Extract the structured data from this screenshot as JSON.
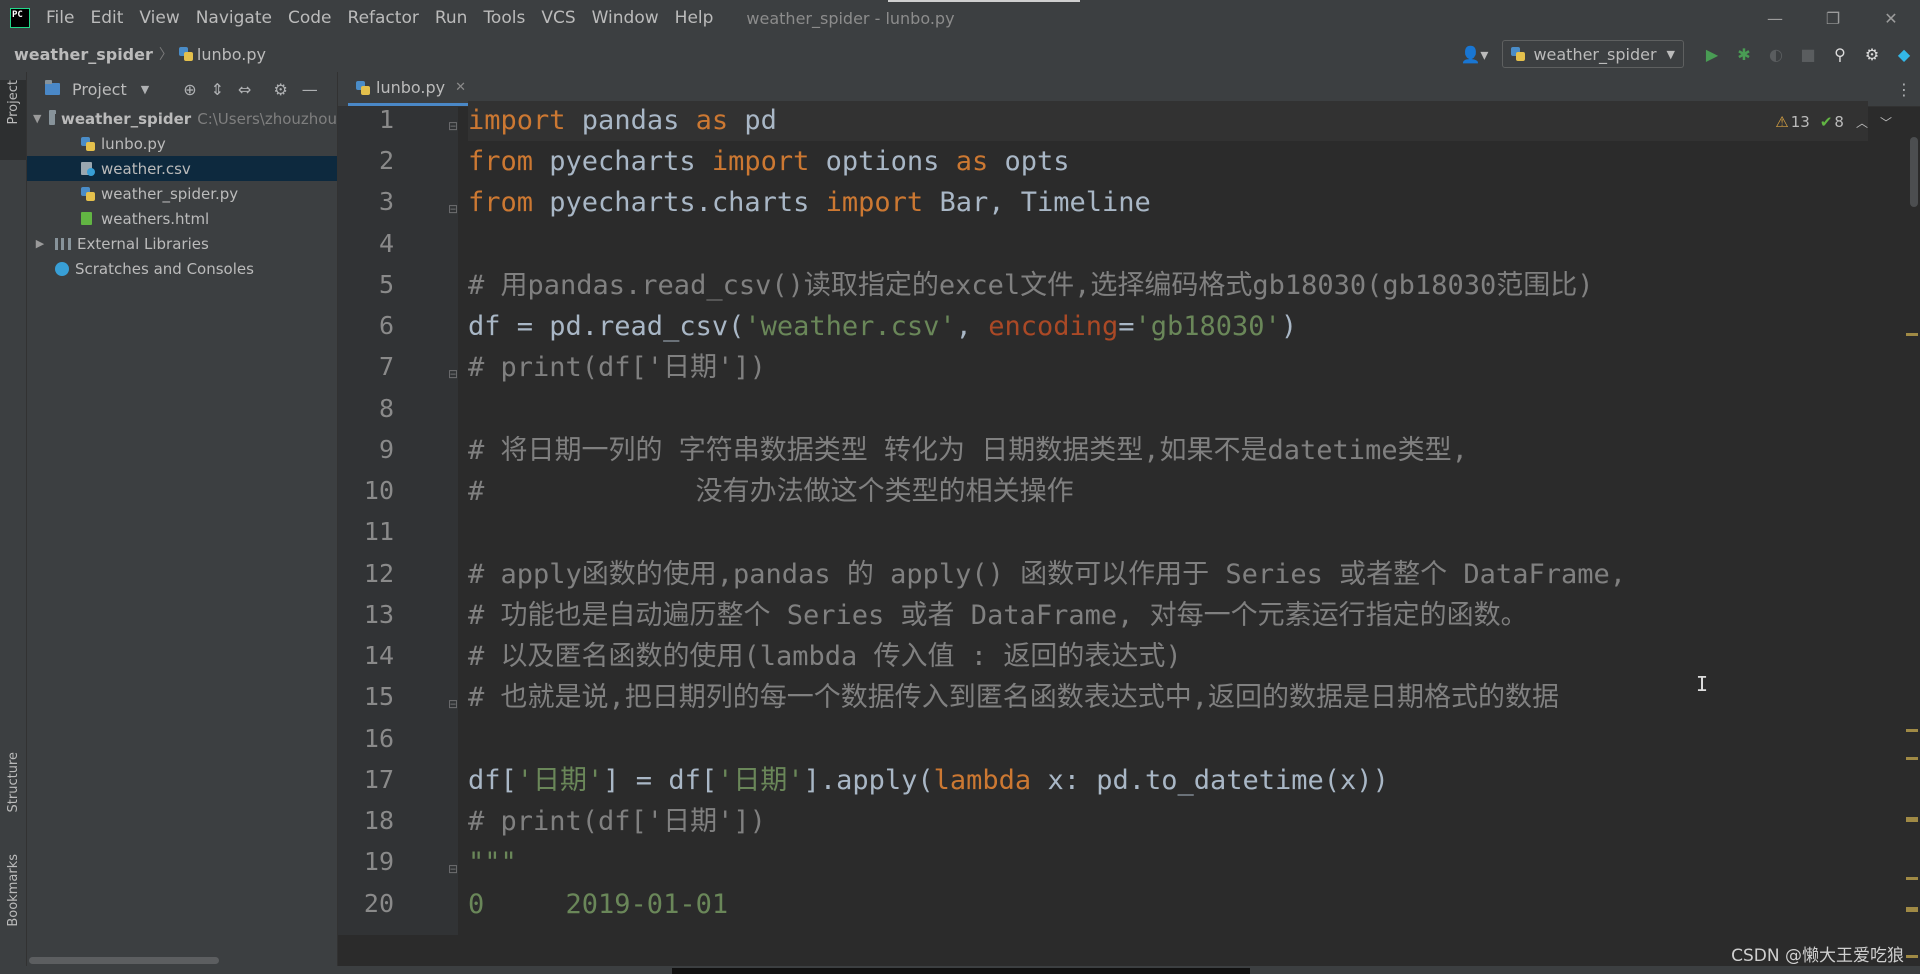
{
  "menu": {
    "items": [
      "File",
      "Edit",
      "View",
      "Navigate",
      "Code",
      "Refactor",
      "Run",
      "Tools",
      "VCS",
      "Window",
      "Help"
    ],
    "window_title": "weather_spider - lunbo.py"
  },
  "window_controls": {
    "minimize": "—",
    "restore": "❐",
    "close": "✕"
  },
  "breadcrumb": {
    "project": "weather_spider",
    "file": "lunbo.py"
  },
  "run_config": {
    "name": "weather_spider"
  },
  "project_panel": {
    "title": "Project",
    "root": {
      "name": "weather_spider",
      "path": "C:\\Users\\zhouzhou"
    },
    "files": [
      "lunbo.py",
      "weather.csv",
      "weather_spider.py",
      "weathers.html"
    ],
    "external_libraries": "External Libraries",
    "scratches": "Scratches and Consoles",
    "selected": "weather.csv"
  },
  "left_strip": {
    "project": "Project",
    "structure": "Structure",
    "bookmarks": "Bookmarks"
  },
  "editor": {
    "tab": "lunbo.py",
    "inspection": {
      "warnings": "13",
      "weak_warnings": "8"
    },
    "line_numbers": [
      "1",
      "2",
      "3",
      "4",
      "5",
      "6",
      "7",
      "8",
      "9",
      "10",
      "11",
      "12",
      "13",
      "14",
      "15",
      "16",
      "17",
      "18",
      "19",
      "20"
    ],
    "code": {
      "l1_kw1": "import",
      "l1_mod": " pandas ",
      "l1_kw2": "as",
      "l1_alias": " pd",
      "l2_kw1": "from",
      "l2_mod": " pyecharts ",
      "l2_kw2": "import",
      "l2_name": " options ",
      "l2_kw3": "as",
      "l2_alias": " opts",
      "l3_kw1": "from",
      "l3_mod": " pyecharts.charts ",
      "l3_kw2": "import",
      "l3_names": " Bar, Timeline",
      "l5": "# 用pandas.read_csv()读取指定的excel文件,选择编码格式gb18030(gb18030范围比)",
      "l6_a": "df = pd.read_csv(",
      "l6_s1": "'weather.csv'",
      "l6_b": ", ",
      "l6_p": "encoding",
      "l6_c": "=",
      "l6_s2": "'gb18030'",
      "l6_d": ")",
      "l7": "# print(df['日期'])",
      "l9": "# 将日期一列的 字符串数据类型 转化为 日期数据类型,如果不是datetime类型,",
      "l10": "#             没有办法做这个类型的相关操作",
      "l12": "# apply函数的使用,pandas 的 apply() 函数可以作用于 Series 或者整个 DataFrame,",
      "l13": "# 功能也是自动遍历整个 Series 或者 DataFrame, 对每一个元素运行指定的函数。",
      "l14": "# 以及匿名函数的使用(lambda 传入值 : 返回的表达式)",
      "l15": "# 也就是说,把日期列的每一个数据传入到匿名函数表达式中,返回的数据是日期格式的数据",
      "l17_a": "df[",
      "l17_s1": "'日期'",
      "l17_b": "] = df[",
      "l17_s2": "'日期'",
      "l17_c": "].apply(",
      "l17_kw": "lambda",
      "l17_d": " x: pd.to_datetime(x))",
      "l18": "# print(df['日期'])",
      "l19": "\"\"\"",
      "l20": "0     2019-01-01"
    }
  },
  "watermark": "CSDN @懒大王爱吃狼"
}
